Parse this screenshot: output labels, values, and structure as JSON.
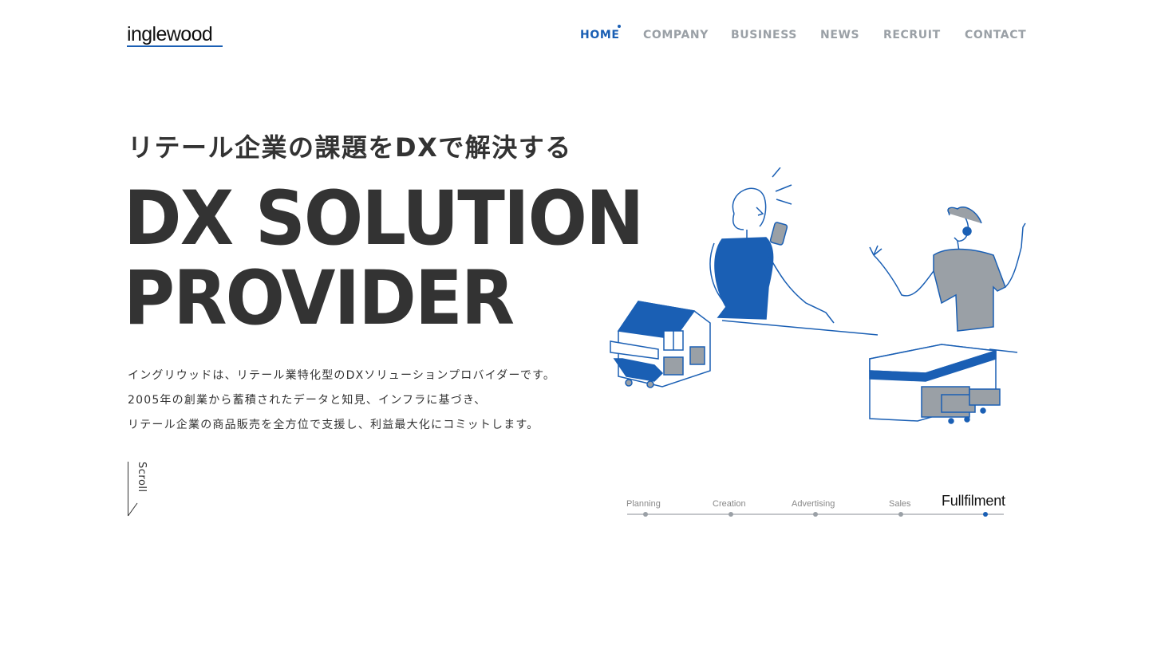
{
  "header": {
    "logo": "inglewood",
    "nav": [
      {
        "label": "HOME",
        "active": true
      },
      {
        "label": "COMPANY",
        "active": false
      },
      {
        "label": "BUSINESS",
        "active": false
      },
      {
        "label": "NEWS",
        "active": false
      },
      {
        "label": "RECRUIT",
        "active": false
      },
      {
        "label": "CONTACT",
        "active": false
      }
    ]
  },
  "hero": {
    "tagline": "リテール企業の課題をDXで解決する",
    "title_line1": "DX SOLUTION",
    "title_line2": "PROVIDER",
    "description": [
      "イングリウッドは、リテール業特化型のDXソリューションプロバイダーです。",
      "2005年の創業から蓄積されたデータと知見、インフラに基づき、",
      "リテール企業の商品販売を全方位で支援し、利益最大化にコミットします。"
    ],
    "scroll_label": "Scroll"
  },
  "steps": {
    "items": [
      "Planning",
      "Creation",
      "Advertising",
      "Sales",
      "Fullfilment"
    ],
    "active": "Fullfilment"
  },
  "colors": {
    "accent": "#1a5fb4",
    "text": "#333333",
    "nav_inactive": "#9aa0a6",
    "illustration_gray": "#9aa0a6"
  }
}
